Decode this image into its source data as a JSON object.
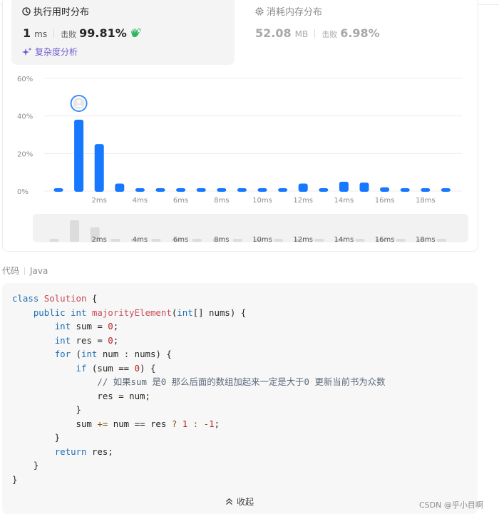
{
  "runtime": {
    "title": "执行用时分布",
    "value": "1",
    "unit": "ms",
    "beats_label": "击败",
    "beats_value": "99.81%"
  },
  "memory": {
    "title": "消耗内存分布",
    "value": "52.08",
    "unit": "MB",
    "beats_label": "击败",
    "beats_value": "6.98%"
  },
  "analysis_label": "复杂度分析",
  "chart_data": {
    "type": "bar",
    "y_ticks": [
      "60%",
      "40%",
      "20%",
      "0%"
    ],
    "ylim": [
      0,
      60
    ],
    "x_tick_labels": [
      "2ms",
      "4ms",
      "6ms",
      "8ms",
      "10ms",
      "12ms",
      "14ms",
      "16ms",
      "18ms"
    ],
    "values": [
      1.5,
      38,
      25,
      4,
      1.5,
      1.5,
      1.5,
      1.5,
      1.5,
      1.5,
      1.5,
      1.5,
      4,
      1.5,
      5,
      4.5,
      2,
      1.5,
      1.5,
      1.5
    ],
    "highlight_index": 1,
    "bar_color": "#1677ff",
    "overview_values": [
      1.5,
      12,
      8,
      1.5,
      1.5,
      1.5,
      1.5,
      1.5,
      1.5,
      1.5,
      1.5,
      1.5,
      1.5,
      1.5,
      1.5,
      1.5,
      1.5,
      1.5,
      1.5,
      1.5
    ]
  },
  "code_tab": {
    "label": "代码",
    "language": "Java"
  },
  "code_lines": [
    [
      [
        "kw",
        "class "
      ],
      [
        "cls",
        "Solution"
      ],
      [
        "p",
        " {"
      ]
    ],
    [
      [
        "p",
        "    "
      ],
      [
        "kw",
        "public int "
      ],
      [
        "fn",
        "majorityElement"
      ],
      [
        "p",
        "("
      ],
      [
        "kw",
        "int"
      ],
      [
        "p",
        "[] nums) {"
      ]
    ],
    [
      [
        "p",
        "        "
      ],
      [
        "kw",
        "int"
      ],
      [
        "p",
        " sum = "
      ],
      [
        "num",
        "0"
      ],
      [
        "p",
        ";"
      ]
    ],
    [
      [
        "p",
        "        "
      ],
      [
        "kw",
        "int"
      ],
      [
        "p",
        " res = "
      ],
      [
        "num",
        "0"
      ],
      [
        "p",
        ";"
      ]
    ],
    [
      [
        "p",
        "        "
      ],
      [
        "kw",
        "for"
      ],
      [
        "p",
        " ("
      ],
      [
        "kw",
        "int"
      ],
      [
        "p",
        " num : nums) {"
      ]
    ],
    [
      [
        "p",
        "            "
      ],
      [
        "kw",
        "if"
      ],
      [
        "p",
        " (sum == "
      ],
      [
        "num",
        "0"
      ],
      [
        "p",
        ") {"
      ]
    ],
    [
      [
        "p",
        "                "
      ],
      [
        "cm",
        "// 如果sum 是0 那么后面的数组加起来一定是大于0 更新当前书为众数"
      ]
    ],
    [
      [
        "p",
        "                res = num;"
      ]
    ],
    [
      [
        "p",
        "            }"
      ]
    ],
    [
      [
        "p",
        "            sum "
      ],
      [
        "op",
        "+="
      ],
      [
        "p",
        " num == res "
      ],
      [
        "op",
        "?"
      ],
      [
        "p",
        " "
      ],
      [
        "num",
        "1"
      ],
      [
        "p",
        " "
      ],
      [
        "op",
        ":"
      ],
      [
        "p",
        " "
      ],
      [
        "op",
        "-"
      ],
      [
        "num",
        "1"
      ],
      [
        "p",
        ";"
      ]
    ],
    [
      [
        "p",
        "        }"
      ]
    ],
    [
      [
        "p",
        "        "
      ],
      [
        "kw",
        "return"
      ],
      [
        "p",
        " res;"
      ]
    ],
    [
      [
        "p",
        "    }"
      ]
    ],
    [
      [
        "p",
        "}"
      ]
    ]
  ],
  "collapse_label": "收起",
  "watermark": "CSDN @乎小目啊"
}
